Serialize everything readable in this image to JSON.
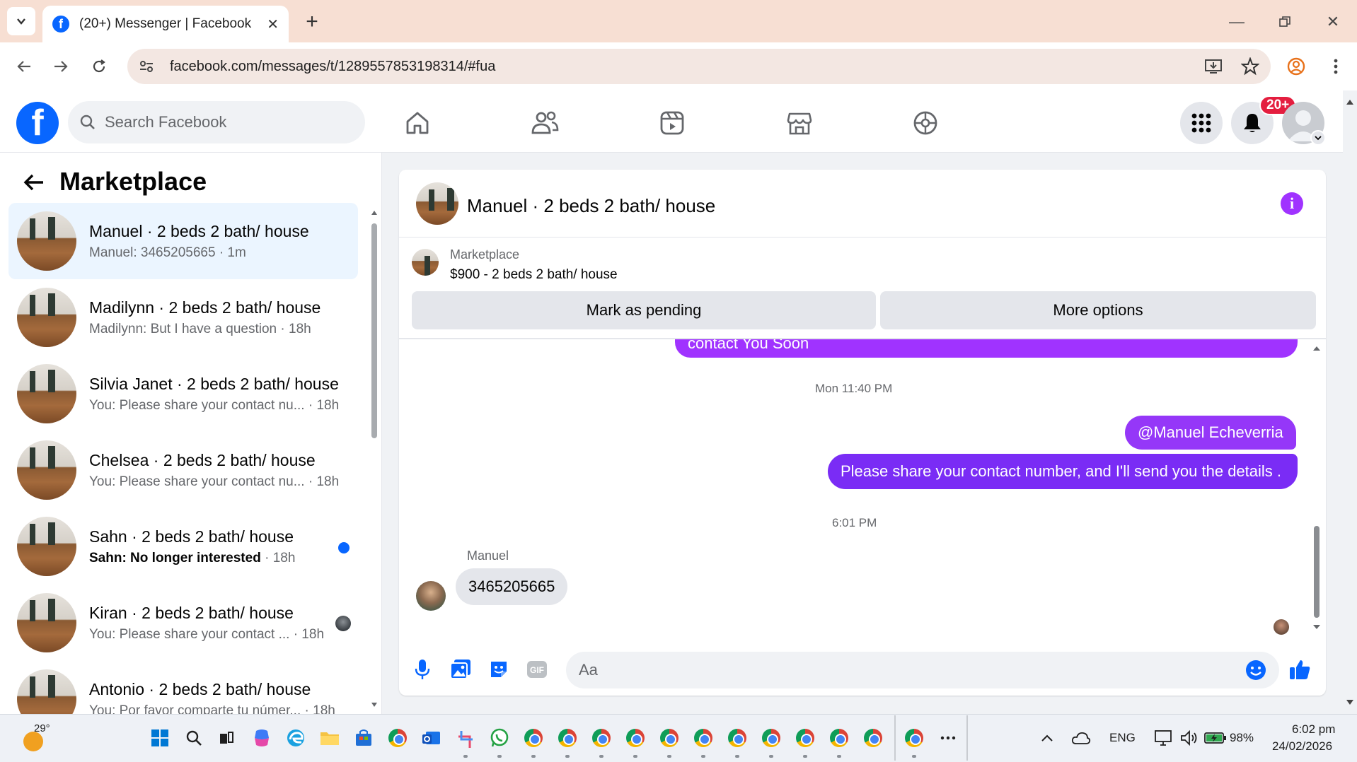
{
  "browser": {
    "tab_title": "(20+) Messenger | Facebook",
    "url": "facebook.com/messages/t/1289557853198314/#fua"
  },
  "header": {
    "search_placeholder": "Search Facebook",
    "notification_count": "20+"
  },
  "left_panel": {
    "title": "Marketplace",
    "conversations": [
      {
        "name": "Manuel · 2 beds 2 bath/ house",
        "snippet": "Manuel: 3465205665",
        "time": "· 1m",
        "active": true
      },
      {
        "name": "Madilynn · 2 beds 2 bath/ house",
        "snippet": "Madilynn: But I have a question",
        "time": "· 18h"
      },
      {
        "name": "Silvia Janet · 2 beds 2 bath/ house",
        "snippet": "You: Please share your contact nu...",
        "time": "· 18h"
      },
      {
        "name": "Chelsea · 2 beds 2 bath/ house",
        "snippet": "You: Please share your contact nu...",
        "time": "· 18h"
      },
      {
        "name": "Sahn · 2 beds 2 bath/ house",
        "snippet": "Sahn: No longer interested",
        "time": "· 18h",
        "unread": true
      },
      {
        "name": "Kiran · 2 beds 2 bath/ house",
        "snippet": "You: Please share your contact ...",
        "time": "· 18h"
      },
      {
        "name": "Antonio · 2 beds 2 bath/ house",
        "snippet": "You: Por favor comparte tu númer...",
        "time": "· 18h"
      }
    ]
  },
  "chat": {
    "title": "Manuel · 2 beds 2 bath/ house",
    "listing_label": "Marketplace",
    "listing_price": "$900 - 2 beds 2 bath/ house",
    "mark_pending_label": "Mark as pending",
    "more_options_label": "More options",
    "messages": {
      "cut_off_text": "contact You Soon",
      "timestamp_1": "Mon 11:40 PM",
      "mention": "@Manuel Echeverria",
      "outgoing_text": "Please share your contact number, and I'll send you the details .",
      "timestamp_2": "6:01 PM",
      "sender_name": "Manuel",
      "incoming_text": "3465205665"
    },
    "input_placeholder": "Aa"
  },
  "taskbar": {
    "weather": "29°",
    "language": "ENG",
    "battery": "98%",
    "time": "6:02 pm",
    "date": "24/02/2026"
  },
  "colors": {
    "facebook_blue": "#0866ff",
    "bubble_violet": "#a033ff",
    "bubble_indigo": "#7a2cf5"
  }
}
